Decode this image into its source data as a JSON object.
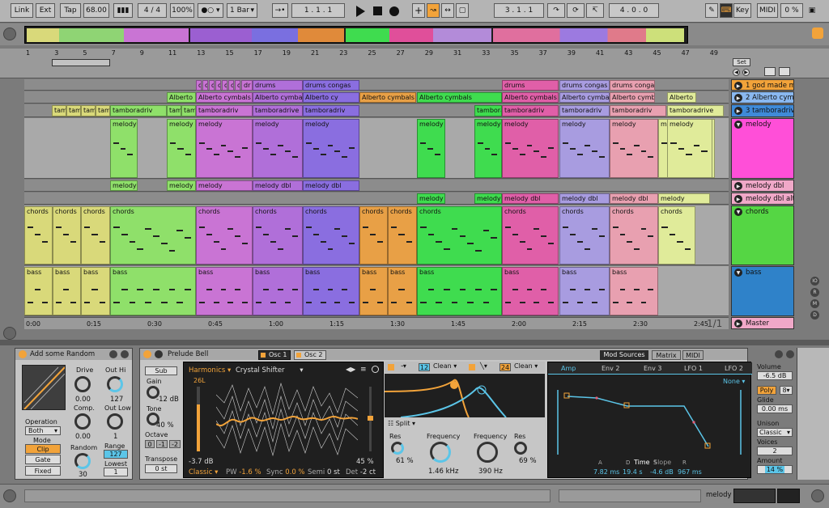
{
  "colors": {
    "accent": "#f2a33a",
    "mod": "#5bc5e8"
  },
  "transport": {
    "link": "Link",
    "ext": "Ext",
    "tap": "Tap",
    "tempo": "68.00",
    "signature": "4 / 4",
    "zoom": "100%",
    "quantize": "1 Bar",
    "arr_pos": "1 .  1 .  1",
    "loop_start": "3 .  1 .  1",
    "loop_len": "4 .  0 .  0",
    "key": "Key",
    "midi": "MIDI",
    "cpu": "0 %"
  },
  "ruler": {
    "bars": [
      "1",
      "3",
      "5",
      "7",
      "9",
      "11",
      "13",
      "15",
      "17",
      "19",
      "21",
      "23",
      "25",
      "27",
      "29",
      "31",
      "33",
      "35",
      "37",
      "39",
      "41",
      "43",
      "45",
      "47",
      "49"
    ],
    "times": [
      "0:00",
      "0:15",
      "0:30",
      "0:45",
      "1:00",
      "1:15",
      "1:30",
      "1:45",
      "2:00",
      "2:15",
      "2:30",
      "2:45"
    ],
    "set_label": "Set",
    "page": "1/1"
  },
  "tracks": {
    "god_made": "1 god made m",
    "alberto": "2 Alberto cym",
    "tambo": "3 tamboradriv",
    "melody": "melody",
    "melody_dbl": "melody dbl",
    "melody_dbl_alt": "melody dbl alt",
    "chords": "chords",
    "bass": "bass",
    "master": "Master"
  },
  "clips": {
    "row1": [
      {
        "n": "d"
      },
      {
        "n": "c"
      },
      {
        "n": "d"
      },
      {
        "n": "c"
      },
      {
        "n": "d"
      },
      {
        "n": "c"
      },
      {
        "n": "d"
      },
      {
        "n": "dr"
      },
      {
        "n": "drums"
      },
      {
        "n": "drums congas"
      },
      {
        "n": "drums"
      },
      {
        "n": "drums congas 1"
      },
      {
        "n": "drums congas"
      }
    ],
    "row2": [
      {
        "n": "Alberto c"
      },
      {
        "n": "Alberto cymbals"
      },
      {
        "n": "Alberto cymbals"
      },
      {
        "n": "Alberto cy"
      },
      {
        "n": "Alberto cymbals"
      },
      {
        "n": "Alberto cymbals"
      },
      {
        "n": "Alberto cymbals"
      },
      {
        "n": "Alberto cymbals"
      },
      {
        "n": "Alberto cymbals"
      },
      {
        "n": "Alberto c"
      }
    ],
    "row3": [
      {
        "n": "tam"
      },
      {
        "n": "tam"
      },
      {
        "n": "tam"
      },
      {
        "n": "tam"
      },
      {
        "n": "tamboradriv"
      },
      {
        "n": "tam"
      },
      {
        "n": "tam"
      },
      {
        "n": "tamboradriv"
      },
      {
        "n": "tamboradrive"
      },
      {
        "n": "tamboradriv"
      },
      {
        "n": "tambora"
      },
      {
        "n": "tamboradriv"
      },
      {
        "n": "tamboradriv"
      },
      {
        "n": "tamboradriv"
      },
      {
        "n": "tamboradrive"
      }
    ],
    "melody": [
      {
        "n": "melody"
      },
      {
        "n": "melody"
      },
      {
        "n": "melody"
      },
      {
        "n": "melody"
      },
      {
        "n": "melody"
      },
      {
        "n": "melody"
      },
      {
        "n": "melody"
      },
      {
        "n": "melody"
      },
      {
        "n": "melody"
      },
      {
        "n": "melody"
      },
      {
        "n": "melody"
      },
      {
        "n": "melody"
      }
    ],
    "dbl": [
      {
        "n": "melody d"
      },
      {
        "n": "melody d"
      },
      {
        "n": "melody"
      },
      {
        "n": "melody dbl"
      },
      {
        "n": "melody dbl"
      }
    ],
    "dblalt": [
      {
        "n": "melody d"
      },
      {
        "n": "melody d"
      },
      {
        "n": "melody dbl"
      },
      {
        "n": "melody dbl"
      },
      {
        "n": "melody dbl"
      },
      {
        "n": "melody"
      }
    ],
    "chords": [
      {
        "n": "chords"
      },
      {
        "n": "chords"
      },
      {
        "n": "chords"
      },
      {
        "n": "chords"
      },
      {
        "n": "chords"
      },
      {
        "n": "chords"
      },
      {
        "n": "chords"
      },
      {
        "n": "chords"
      },
      {
        "n": "chords"
      },
      {
        "n": "chords"
      },
      {
        "n": "chords"
      },
      {
        "n": "chords"
      },
      {
        "n": "chords"
      },
      {
        "n": "chords"
      }
    ],
    "bass": [
      {
        "n": "bass"
      },
      {
        "n": "bass"
      },
      {
        "n": "bass"
      },
      {
        "n": "bass"
      },
      {
        "n": "bass"
      },
      {
        "n": "bass"
      },
      {
        "n": "bass"
      },
      {
        "n": "bass"
      },
      {
        "n": "bass"
      },
      {
        "n": "bass"
      },
      {
        "n": "bass"
      },
      {
        "n": "bass"
      },
      {
        "n": "bass"
      }
    ]
  },
  "random": {
    "title": "Add some Random",
    "drive_lbl": "Drive",
    "drive": "0.00",
    "outhi_lbl": "Out Hi",
    "outhi": "127",
    "comp_lbl": "Comp.",
    "comp": "0.00",
    "outlow_lbl": "Out Low",
    "outlow": "1",
    "op_lbl": "Operation",
    "op": "Both",
    "mode_lbl": "Mode",
    "clip": "Clip",
    "gate": "Gate",
    "fixed": "Fixed",
    "random_lbl": "Random",
    "random": "30",
    "range_lbl": "Range",
    "range": "127",
    "lowest_lbl": "Lowest",
    "lowest": "1"
  },
  "synth": {
    "title": "Prelude Bell",
    "osc1": "Osc 1",
    "osc2": "Osc 2",
    "sub": "Sub",
    "gain_lbl": "Gain",
    "gain": "-12 dB",
    "tone_lbl": "Tone",
    "tone": "40 %",
    "octave_lbl": "Octave",
    "oct0": "0",
    "oct1": "-1",
    "oct2": "-2",
    "transpose_lbl": "Transpose",
    "transpose": "0 st",
    "harmonics": "Harmonics",
    "crystal": "Crystal Shifter",
    "wt_pos": "26L",
    "level": "-3.7 dB",
    "pct": "45 %",
    "classic": "Classic",
    "pw_lbl": "PW",
    "pw": "-1.6 %",
    "sync_lbl": "Sync",
    "sync": "0.0 %",
    "semi_lbl": "Semi",
    "semi": "0 st",
    "det_lbl": "Det",
    "det": "-2 ct",
    "f1_slope": "12",
    "f1_type": "Clean",
    "f2_slope": "24",
    "f2_type": "Clean",
    "split": "Split",
    "res_lbl": "Res",
    "res1": "61 %",
    "freq_lbl": "Frequency",
    "freq1": "1.46 kHz",
    "freq2": "390 Hz",
    "res2": "69 %"
  },
  "mod": {
    "tab1": "Mod Sources",
    "tab2": "Matrix",
    "tab3": "MIDI",
    "amp": "Amp",
    "env2": "Env 2",
    "env3": "Env 3",
    "lfo1": "LFO 1",
    "lfo2": "LFO 2",
    "none": "None",
    "time": "Time",
    "slope": "Slope",
    "A": "A",
    "D": "D",
    "S": "S",
    "R": "R",
    "a": "7.82 ms",
    "d": "19.4 s",
    "s": "-4.6 dB",
    "r": "967 ms"
  },
  "global": {
    "volume_lbl": "Volume",
    "volume": "-6.5 dB",
    "poly": "Poly",
    "voices_n": "8",
    "glide_lbl": "Glide",
    "glide": "0.00 ms",
    "unison_lbl": "Unison",
    "unison": "Classic",
    "voices_lbl": "Voices",
    "voices": "2",
    "amount_lbl": "Amount",
    "amount": "14 %"
  },
  "status": {
    "track": "melody"
  }
}
